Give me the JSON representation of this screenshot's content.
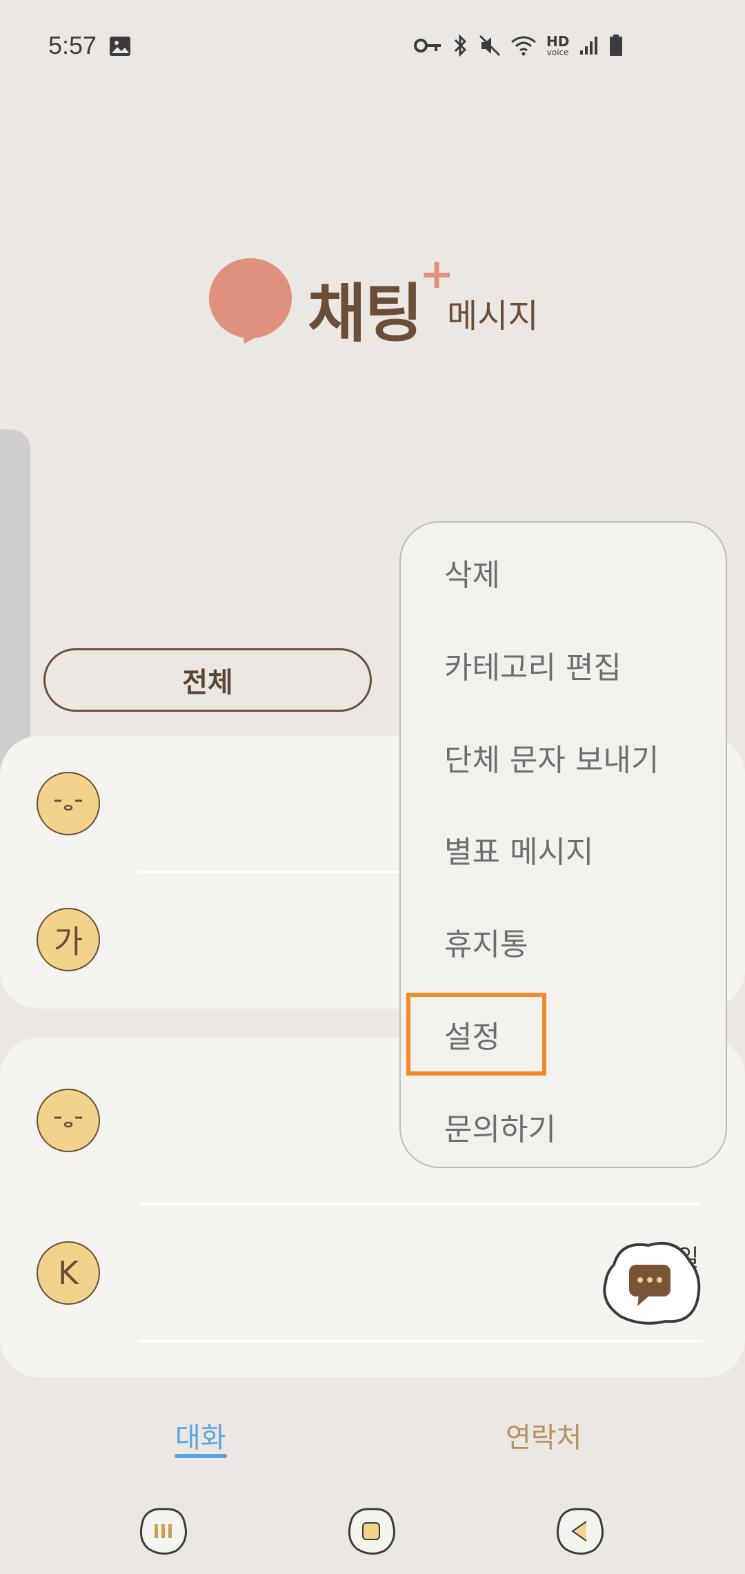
{
  "status_bar": {
    "time": "5:57",
    "icons": [
      "image-icon",
      "key-icon",
      "bluetooth-icon",
      "mute-icon",
      "wifi-icon",
      "hd-voice-icon",
      "signal-icon",
      "battery-icon"
    ],
    "hd_label": "HD",
    "voice_label": "voice"
  },
  "logo": {
    "title": "채팅",
    "subtitle": "메시지",
    "plus": "+"
  },
  "filter": {
    "all_label": "전체"
  },
  "conversations": [
    {
      "avatar_text": "",
      "avatar_kind": "face-icon"
    },
    {
      "avatar_text": "가",
      "avatar_kind": "letter"
    },
    {
      "avatar_text": "",
      "avatar_kind": "face-icon"
    },
    {
      "avatar_text": "K",
      "avatar_kind": "letter",
      "meta": "일"
    }
  ],
  "menu": {
    "items": [
      "삭제",
      "카테고리 편집",
      "단체 문자 보내기",
      "별표 메시지",
      "휴지통",
      "설정",
      "문의하기"
    ],
    "highlighted": "설정"
  },
  "bottom_tabs": {
    "chats": "대화",
    "contacts": "연락처"
  },
  "colors": {
    "background": "#ebe8e3",
    "brown": "#6b4d38",
    "accent_blue": "#5aa6e0",
    "logo_coral": "#e0917d",
    "avatar_yellow": "#f2d38c",
    "highlight_orange": "#f08a2c"
  }
}
